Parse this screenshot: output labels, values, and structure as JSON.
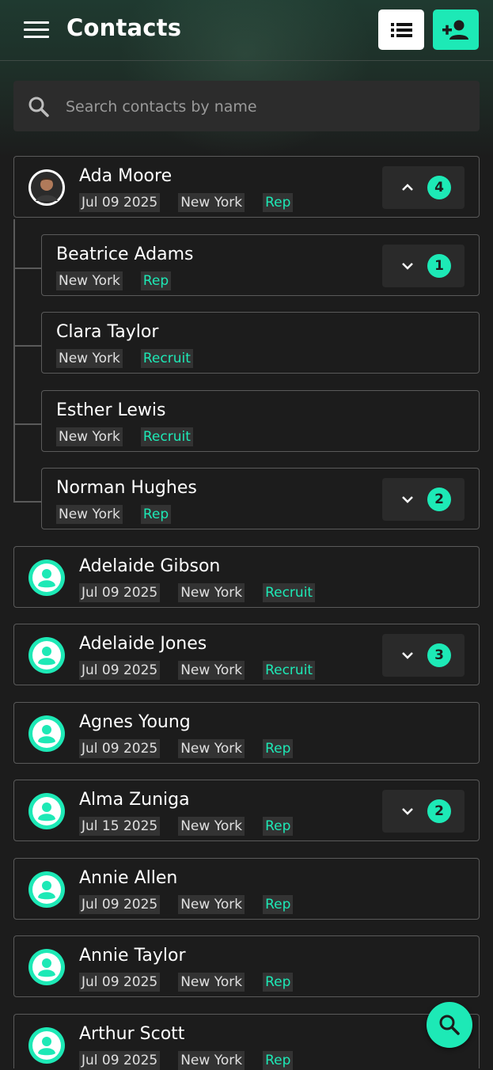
{
  "header": {
    "title": "Contacts",
    "menu_icon": "hamburger-menu-icon",
    "list_icon": "list-view-icon",
    "add_icon": "add-person-icon"
  },
  "search": {
    "placeholder": "Search contacts by name",
    "value": ""
  },
  "contacts": [
    {
      "name": "Ada Moore",
      "date": "Jul 09 2025",
      "location": "New York",
      "role": "Rep",
      "avatar": "photo",
      "count": "4",
      "expanded": true,
      "children": [
        {
          "name": "Beatrice Adams",
          "location": "New York",
          "role": "Rep",
          "count": "1"
        },
        {
          "name": "Clara Taylor",
          "location": "New York",
          "role": "Recruit",
          "count": null
        },
        {
          "name": "Esther Lewis",
          "location": "New York",
          "role": "Recruit",
          "count": null
        },
        {
          "name": "Norman Hughes",
          "location": "New York",
          "role": "Rep",
          "count": "2"
        }
      ]
    },
    {
      "name": "Adelaide Gibson",
      "date": "Jul 09 2025",
      "location": "New York",
      "role": "Recruit",
      "avatar": "generic",
      "count": null
    },
    {
      "name": "Adelaide Jones",
      "date": "Jul 09 2025",
      "location": "New York",
      "role": "Recruit",
      "avatar": "generic",
      "count": "3"
    },
    {
      "name": "Agnes Young",
      "date": "Jul 09 2025",
      "location": "New York",
      "role": "Rep",
      "avatar": "generic",
      "count": null
    },
    {
      "name": "Alma Zuniga",
      "date": "Jul 15 2025",
      "location": "New York",
      "role": "Rep",
      "avatar": "generic",
      "count": "2"
    },
    {
      "name": "Annie Allen",
      "date": "Jul 09 2025",
      "location": "New York",
      "role": "Rep",
      "avatar": "generic",
      "count": null
    },
    {
      "name": "Annie Taylor",
      "date": "Jul 09 2025",
      "location": "New York",
      "role": "Rep",
      "avatar": "generic",
      "count": null
    },
    {
      "name": "Arthur Scott",
      "date": "Jul 09 2025",
      "location": "New York",
      "role": "Rep",
      "avatar": "generic",
      "count": null
    }
  ],
  "fab": {
    "icon": "search-icon"
  },
  "colors": {
    "accent": "#1de9b6",
    "background": "#1c1c1c",
    "card_border": "#5a5a5a",
    "tag_background": "#333333"
  }
}
